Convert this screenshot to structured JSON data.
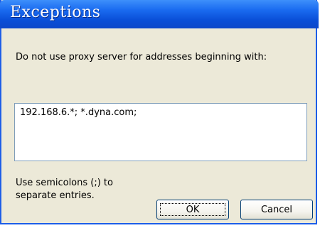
{
  "window": {
    "title": "Exceptions"
  },
  "prompt_text": "Do not use proxy server for addresses beginning with:",
  "exceptions_value": "192.168.6.*; *.dyna.com;",
  "hint": {
    "line1": "Use semicolons (;) to",
    "line2": "separate entries."
  },
  "buttons": {
    "ok_label": "OK",
    "cancel_label": "Cancel"
  },
  "colors": {
    "titlebar": "#0a4fd8",
    "dialog_bg": "#ece9d8",
    "field_border": "#7f9db9",
    "button_border": "#003c74"
  }
}
